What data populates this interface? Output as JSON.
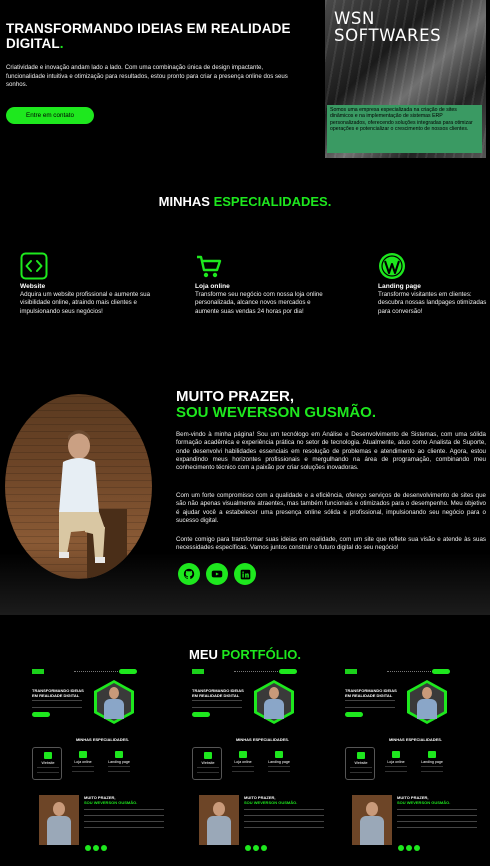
{
  "hero": {
    "title": "TRANSFORMANDO IDEIAS EM REALIDADE DIGITAL",
    "title_dot": ".",
    "text": "Criatividade e inovação andam lado a lado. Com uma combinação única de design impactante, funcionalidade intuitiva e otimização para resultados, estou pronto para criar a presença online dos seus sonhos.",
    "cta": "Entre em contato"
  },
  "brand_card": {
    "title_line1": "WSN",
    "title_line2": "SOFTWARES",
    "description": "Somos uma empresa especializada na criação de sites dinâmicos e na implementação de sistemas ERP personalizados, oferecendo soluções integradas para otimizar operações e potencializar o crescimento de nossos clientes."
  },
  "specialties": {
    "title_white": "MINHAS",
    "title_green": "ESPECIALIDADES.",
    "items": [
      {
        "icon": "code-icon",
        "name": "Website",
        "desc": "Adquira um website profissional e aumente sua visibilidade online, atraindo mais clientes e impulsionando seus negócios!"
      },
      {
        "icon": "cart-icon",
        "name": "Loja online",
        "desc": "Transforme seu negócio com nossa loja online personalizada, alcance novos mercados e aumente suas vendas 24 horas por dia!"
      },
      {
        "icon": "wordpress-icon",
        "name": "Landing page",
        "desc": "Transforme visitantes em clientes: descubra nossas landpages otimizadas para conversão!"
      }
    ]
  },
  "about": {
    "heading1": "MUITO PRAZER,",
    "heading2": "SOU WEVERSON GUSMÃO.",
    "p1": "Bem-vindo à minha página! Sou um tecnólogo em Análise e Desenvolvimento de Sistemas, com uma sólida formação acadêmica e experiência prática no setor de tecnologia. Atualmente, atuo como Analista de Suporte, onde desenvolvi habilidades essenciais em resolução de problemas e atendimento ao cliente. Agora, estou expandindo meus horizontes profissionais e mergulhando na área de programação, combinando meu conhecimento técnico com a paixão por criar soluções inovadoras.",
    "p2": "Com um forte compromisso com a qualidade e a eficiência, ofereço serviços de desenvolvimento de sites que são não apenas visualmente atraentes, mas também funcionais e otimizados para o desempenho. Meu objetivo é ajudar você a estabelecer uma presença online sólida e profissional, impulsionando seu negócio para o sucesso digital.",
    "p3": "Conte comigo para transformar suas ideias em realidade, com um site que reflete sua visão e atende às suas necessidades específicas. Vamos juntos construir o futuro digital do seu negócio!",
    "social": [
      "github-icon",
      "youtube-icon",
      "linkedin-icon"
    ]
  },
  "portfolio": {
    "title_white": "MEU",
    "title_green": "PORTFÓLIO.",
    "thumb": {
      "hero_title": "TRANSFORMANDO IDEIAS EM REALIDADE DIGITAL",
      "section": "MINHAS ESPECIALIDADES.",
      "cards": [
        "Website",
        "Loja online",
        "Landing page"
      ],
      "about_h1": "MUITO PRAZER,",
      "about_h2": "SOU WEVERSON GUSMÃO."
    }
  },
  "colors": {
    "accent": "#1ee81e",
    "background": "#000000",
    "brand_box": "#3a9a63"
  }
}
